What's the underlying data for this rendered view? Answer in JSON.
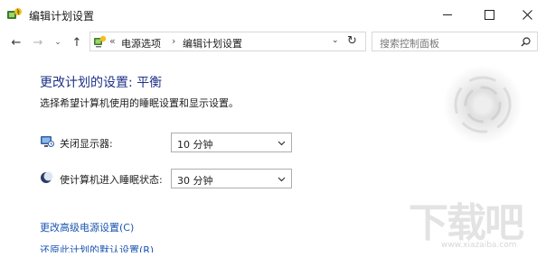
{
  "window": {
    "title": "编辑计划设置",
    "buttons": {
      "minimize": "minimize",
      "maximize": "maximize",
      "close": "close"
    }
  },
  "nav": {
    "back_icon": "←",
    "forward_icon": "→",
    "recent_icon": "⌄",
    "up_icon": "↑",
    "breadcrumb": {
      "root_sep": "«",
      "items": [
        "电源选项",
        "编辑计划设置"
      ],
      "sep": "›"
    },
    "dropdown_icon": "⌄",
    "refresh_icon": "↻",
    "search_placeholder": "搜索控制面板"
  },
  "main": {
    "heading": "更改计划的设置: 平衡",
    "subtitle": "选择希望计算机使用的睡眠设置和显示设置。",
    "settings": [
      {
        "label": "关闭显示器:",
        "value": "10 分钟",
        "icon": "monitor-icon"
      },
      {
        "label": "使计算机进入睡眠状态:",
        "value": "30 分钟",
        "icon": "sleep-moon-icon"
      }
    ],
    "links": {
      "advanced": "更改高级电源设置(C)",
      "restore": "还原此计划的默认设置(R)"
    }
  },
  "watermark": {
    "logo_text": "下载吧",
    "site": "www.xiazaiba.com"
  }
}
